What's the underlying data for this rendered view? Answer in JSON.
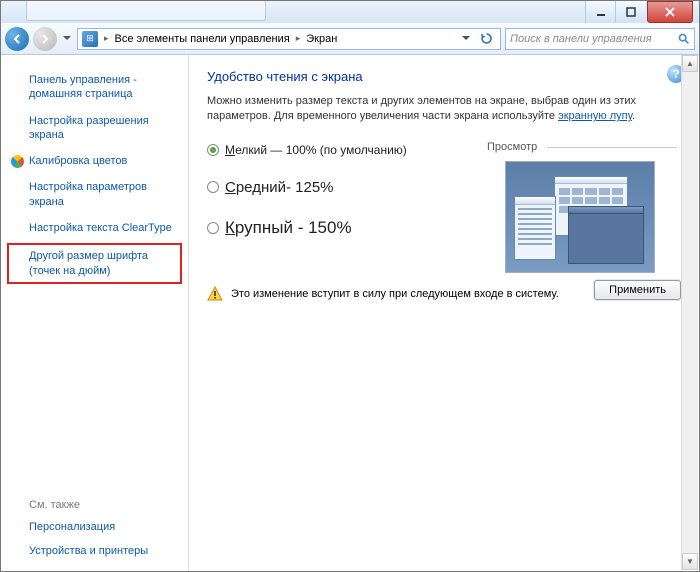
{
  "titlebar": {
    "min": "_",
    "max": "▢",
    "close": "✕"
  },
  "nav": {
    "breadcrumb_root": "Все элементы панели управления",
    "breadcrumb_current": "Экран",
    "search_placeholder": "Поиск в панели управления"
  },
  "sidebar": {
    "links": [
      "Панель управления - домашняя страница",
      "Настройка разрешения экрана",
      "Калибровка цветов",
      "Настройка параметров экрана",
      "Настройка текста ClearType",
      "Другой размер шрифта (точек на дюйм)"
    ],
    "see_also": "См. также",
    "footer_links": [
      "Персонализация",
      "Устройства и принтеры"
    ]
  },
  "main": {
    "help": "?",
    "heading": "Удобство чтения с экрана",
    "desc1": "Можно изменить размер текста и других элементов на экране, выбрав один из этих параметров. Для временного увеличения части экрана используйте ",
    "desc_link": "экранную лупу",
    "desc2": ".",
    "options": [
      {
        "first": "М",
        "rest": "елкий — 100% (по умолчанию)",
        "selected": true
      },
      {
        "first": "С",
        "rest": "редний- 125%",
        "selected": false
      },
      {
        "first": "К",
        "rest": "рупный - 150%",
        "selected": false
      }
    ],
    "preview_label": "Просмотр",
    "warning": "Это изменение вступит в силу при следующем входе в систему.",
    "apply": "Применить"
  }
}
